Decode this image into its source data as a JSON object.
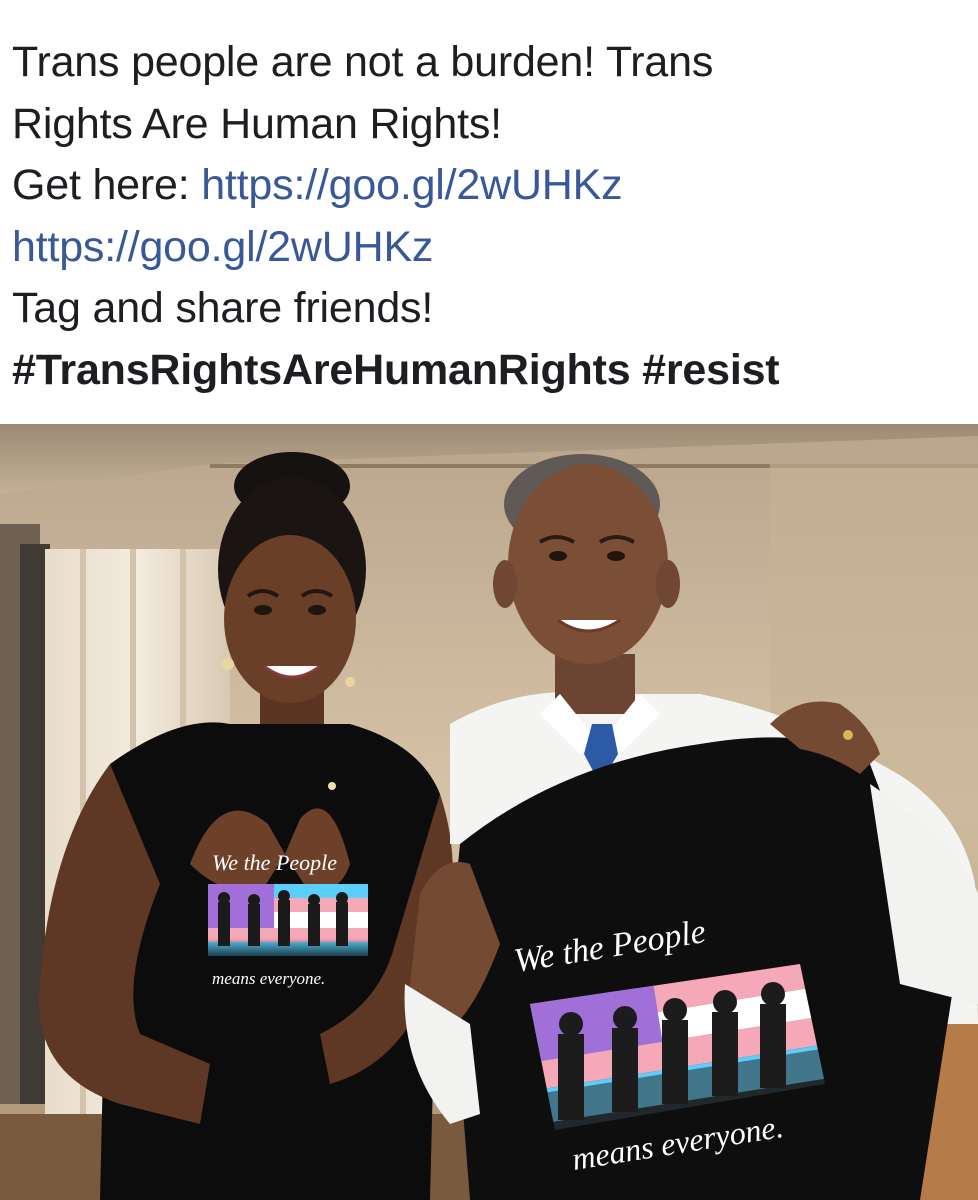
{
  "post": {
    "line1": "Trans people are not a burden! Trans",
    "line2": "Rights Are Human Rights!",
    "get_here_label": "Get here: ",
    "link1": "https://goo.gl/2wUHKz",
    "link2": "https://goo.gl/2wUHKz",
    "line5": "Tag and share friends!",
    "hashtag1": "#TransRightsAreHumanRights",
    "hashtag2": "#resist"
  },
  "photo": {
    "shirt_left": {
      "line1": "We the People",
      "line2": "means everyone."
    },
    "shirt_right": {
      "line1": "We the People",
      "line2": "means everyone."
    }
  },
  "colors": {
    "text": "#1c1e21",
    "link": "#385898",
    "trans_blue": "#5bcefa",
    "trans_pink": "#f5a9b8",
    "flag_purple": "#a070d8"
  }
}
